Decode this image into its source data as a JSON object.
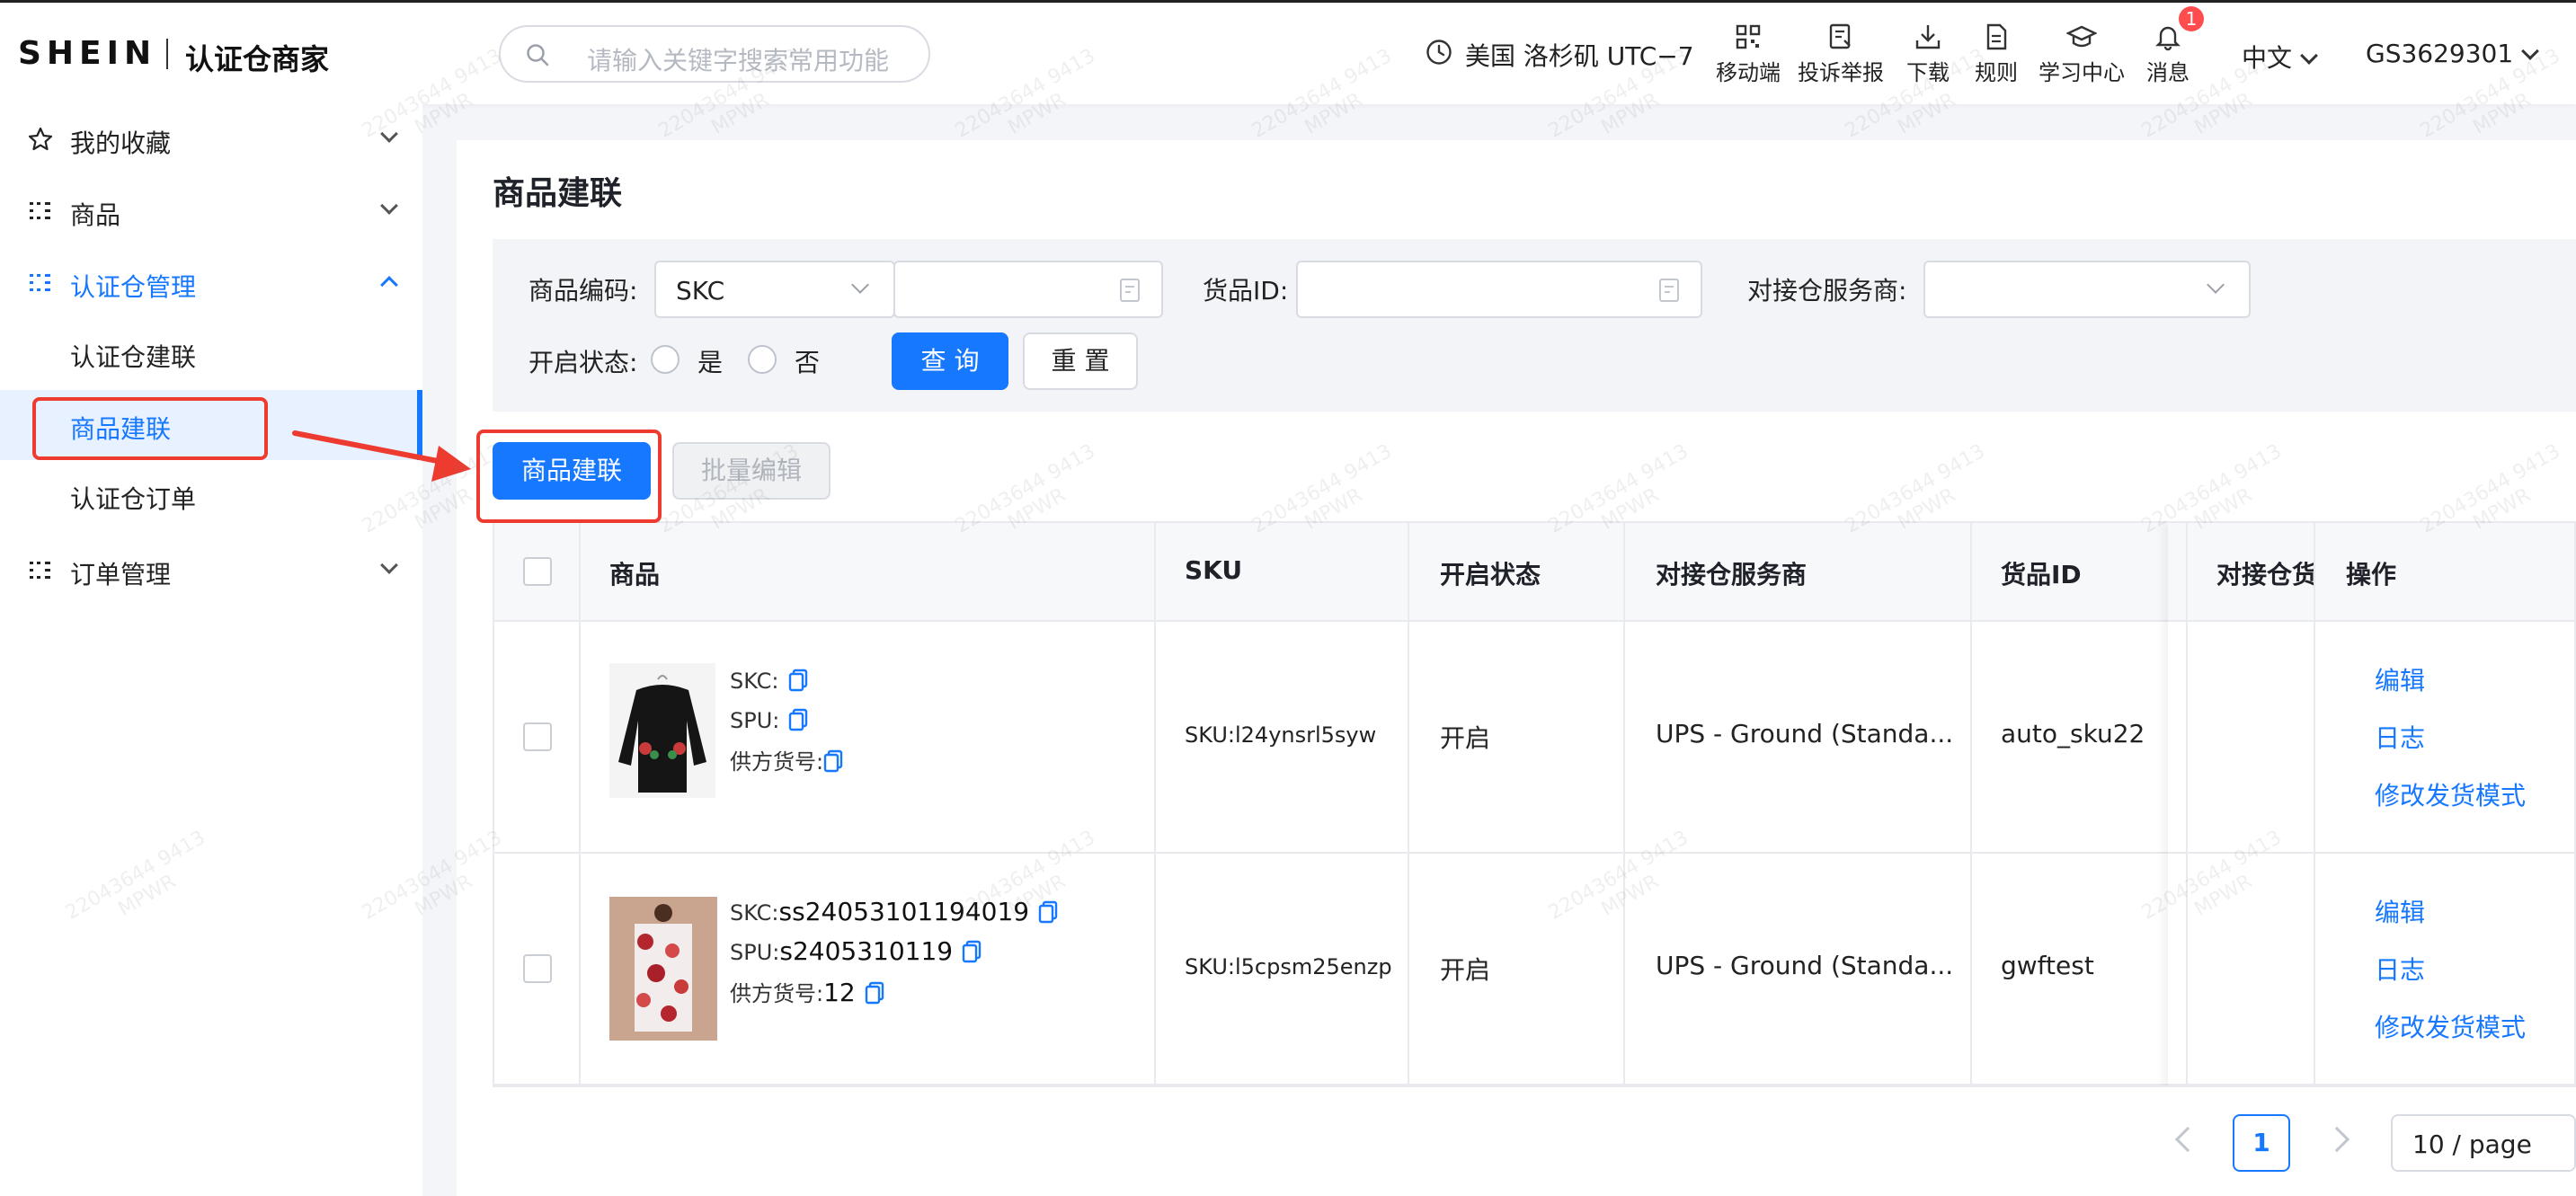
{
  "header": {
    "logo": "SHEIN",
    "subtitle": "认证仓商家",
    "search_placeholder": "请输入关键字搜索常用功能",
    "timezone": "美国 洛杉矶 UTC−7",
    "nav": [
      {
        "label": "移动端",
        "icon": "mobile-qr-icon"
      },
      {
        "label": "投诉举报",
        "icon": "report-icon"
      },
      {
        "label": "下载",
        "icon": "download-icon"
      },
      {
        "label": "规则",
        "icon": "rules-doc-icon"
      },
      {
        "label": "学习中心",
        "icon": "graduation-cap-icon"
      },
      {
        "label": "消息",
        "icon": "bell-icon",
        "badge": "1"
      }
    ],
    "language": "中文",
    "account": "GS3629301"
  },
  "sidebar": {
    "items": [
      {
        "label": "我的收藏",
        "icon": "star-icon"
      },
      {
        "label": "商品",
        "icon": "list-icon"
      },
      {
        "label": "认证仓管理",
        "icon": "list-icon"
      },
      {
        "label": "订单管理",
        "icon": "list-icon"
      }
    ],
    "sub_items": [
      {
        "label": "认证仓建联"
      },
      {
        "label": "商品建联"
      },
      {
        "label": "认证仓订单"
      }
    ]
  },
  "page": {
    "title": "商品建联",
    "filters": {
      "code_label": "商品编码:",
      "code_type": "SKC",
      "code_value": "",
      "goods_id_label": "货品ID:",
      "goods_id_value": "",
      "provider_label": "对接仓服务商:",
      "provider_value": "",
      "status_label": "开启状态:",
      "status_yes": "是",
      "status_no": "否",
      "search_button": "查 询",
      "reset_button": "重 置"
    },
    "actions": {
      "link_button": "商品建联",
      "batch_edit_button": "批量编辑"
    },
    "table": {
      "headers": [
        "商品",
        "SKU",
        "开启状态",
        "对接仓服务商",
        "货品ID",
        "对接仓货",
        "操作"
      ],
      "rows": [
        {
          "skc_label": "SKC:",
          "skc": "",
          "spu_label": "SPU:",
          "spu": "",
          "supplier_label": "供方货号:",
          "supplier": "",
          "sku": "SKU:l24ynsrl5syw",
          "status": "开启",
          "provider": "UPS - Ground (Standa...",
          "goods_id": "auto_sku22",
          "ops": [
            "编辑",
            "日志",
            "修改发货模式"
          ]
        },
        {
          "skc_label": "SKC:",
          "skc": "ss24053101194019",
          "spu_label": "SPU:",
          "spu": "s2405310119",
          "supplier_label": "供方货号:",
          "supplier": "12",
          "sku": "SKU:l5cpsm25enzp",
          "status": "开启",
          "provider": "UPS - Ground (Standa...",
          "goods_id": "gwftest",
          "ops": [
            "编辑",
            "日志",
            "修改发货模式"
          ]
        }
      ]
    },
    "pagination": {
      "current_page": "1",
      "page_size": "10 / page"
    }
  },
  "watermark": {
    "line1": "22043644 9413",
    "line2": "MPWR"
  },
  "colors": {
    "primary": "#1677ff",
    "highlight": "#ee3b30",
    "badge": "#ff4d4f"
  }
}
